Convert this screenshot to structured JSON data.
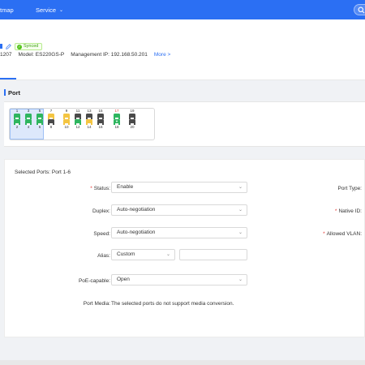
{
  "topnav": {
    "items": [
      {
        "label": "tmap",
        "chevron": false
      },
      {
        "label": "Service",
        "chevron": true
      }
    ],
    "search_icon": "search-icon"
  },
  "device": {
    "status": "Synced",
    "serial_fragment": "1207",
    "model_label": "Model: ES220GS-P",
    "mgmt_ip_label": "Management IP: 192.168.50.201",
    "more_link": "More >"
  },
  "section": {
    "title": "Port"
  },
  "ports": [
    {
      "num": "1",
      "color": "green",
      "icon": "",
      "selected": true
    },
    {
      "num": "2",
      "color": "green",
      "icon": "",
      "selected": true
    },
    {
      "num": "3",
      "color": "green",
      "icon": "",
      "selected": true
    },
    {
      "num": "4",
      "color": "green",
      "icon": "",
      "selected": true
    },
    {
      "num": "5",
      "color": "green",
      "icon": "",
      "selected": true
    },
    {
      "num": "6",
      "color": "green",
      "icon": "",
      "selected": true
    },
    {
      "num": "7",
      "color": "yellow",
      "icon": "",
      "selected": false
    },
    {
      "num": "8",
      "color": "dark",
      "icon": "",
      "selected": false
    },
    {
      "num": "9",
      "color": "yellow",
      "icon": "",
      "selected": false
    },
    {
      "num": "10",
      "color": "yellow",
      "icon": "",
      "selected": false
    },
    {
      "num": "11",
      "color": "dark",
      "icon": "",
      "selected": false
    },
    {
      "num": "12",
      "color": "green",
      "icon": "",
      "selected": false
    },
    {
      "num": "13",
      "color": "dark",
      "icon": "",
      "selected": false
    },
    {
      "num": "14",
      "color": "yellow",
      "icon": "",
      "selected": false
    },
    {
      "num": "15",
      "color": "dark",
      "icon": "",
      "selected": false
    },
    {
      "num": "16",
      "color": "dark",
      "icon": "",
      "selected": false
    },
    {
      "num": "17",
      "color": "green",
      "icon": "",
      "selected": false
    },
    {
      "num": "18",
      "color": "green",
      "icon": "arrow-down",
      "selected": false
    },
    {
      "num": "19",
      "color": "dark",
      "icon": "",
      "selected": false
    },
    {
      "num": "20",
      "color": "dark",
      "icon": "",
      "selected": false
    }
  ],
  "form": {
    "selected_ports": "Selected Ports: Port 1-6",
    "status": {
      "label": "Status:",
      "required": true,
      "value": "Enable"
    },
    "duplex": {
      "label": "Duplex:",
      "required": false,
      "value": "Auto-negotiation"
    },
    "speed": {
      "label": "Speed:",
      "required": false,
      "value": "Auto-negotiation"
    },
    "alias": {
      "label": "Alias:",
      "required": false,
      "value": "Custom",
      "text_value": ""
    },
    "poe": {
      "label": "PoE-capable:",
      "required": false,
      "value": "Open"
    },
    "port_media": {
      "label": "Port Media:",
      "text": "The selected ports do not support media conversion."
    },
    "right": {
      "port_type": "Port Type:",
      "native_id": "Native ID:",
      "allowed_vlan": "Allowed VLAN:"
    }
  }
}
